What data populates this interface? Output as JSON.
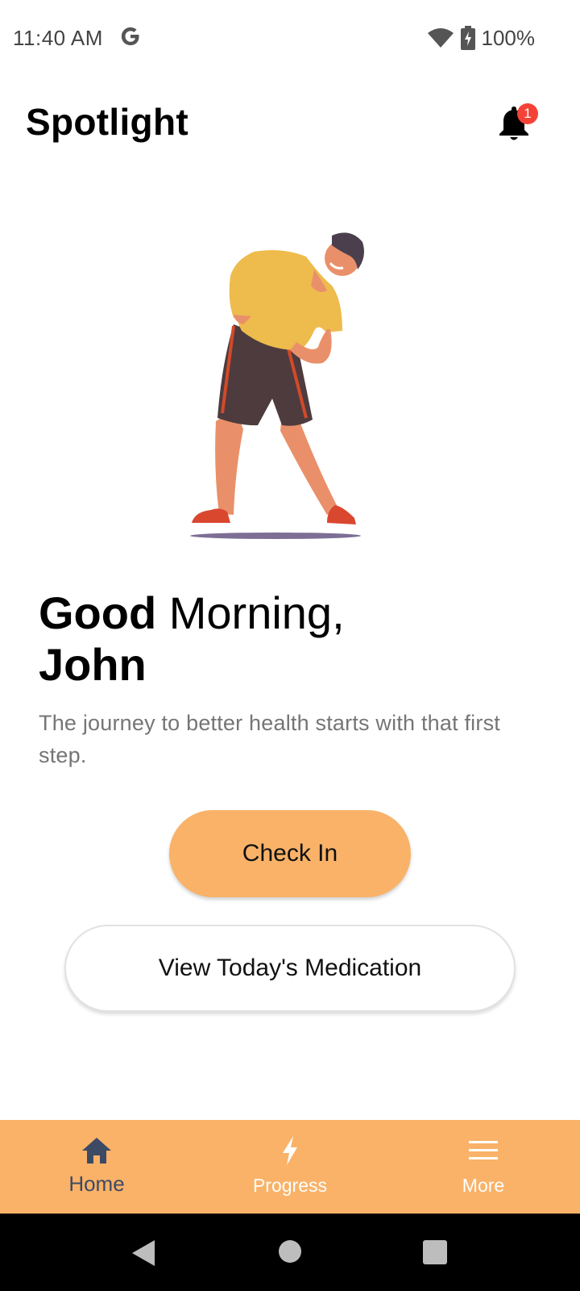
{
  "status_bar": {
    "time": "11:40 AM",
    "google_icon": "google-g-icon",
    "battery_percent": "100%",
    "wifi_icon": "wifi-icon",
    "battery_icon": "battery-charging-icon"
  },
  "header": {
    "title": "Spotlight",
    "notification_icon": "bell-icon",
    "notification_count": "1"
  },
  "hero": {
    "illustration": "man-stretching-illustration"
  },
  "greeting": {
    "salutation": "Good",
    "time_of_day": " Morning,",
    "name": "John",
    "subtext": "The journey to better health starts with that first step."
  },
  "actions": {
    "check_in_label": "Check In",
    "medication_label": "View Today's Medication"
  },
  "bottom_nav": {
    "items": [
      {
        "label": "Home",
        "icon": "home-icon",
        "active": true
      },
      {
        "label": "Progress",
        "icon": "lightning-bolt-icon",
        "active": false
      },
      {
        "label": "More",
        "icon": "menu-icon",
        "active": false
      }
    ]
  },
  "colors": {
    "accent": "#f9b268",
    "active_nav": "#3d4a66",
    "badge": "#f44336",
    "subtext": "#757575"
  }
}
